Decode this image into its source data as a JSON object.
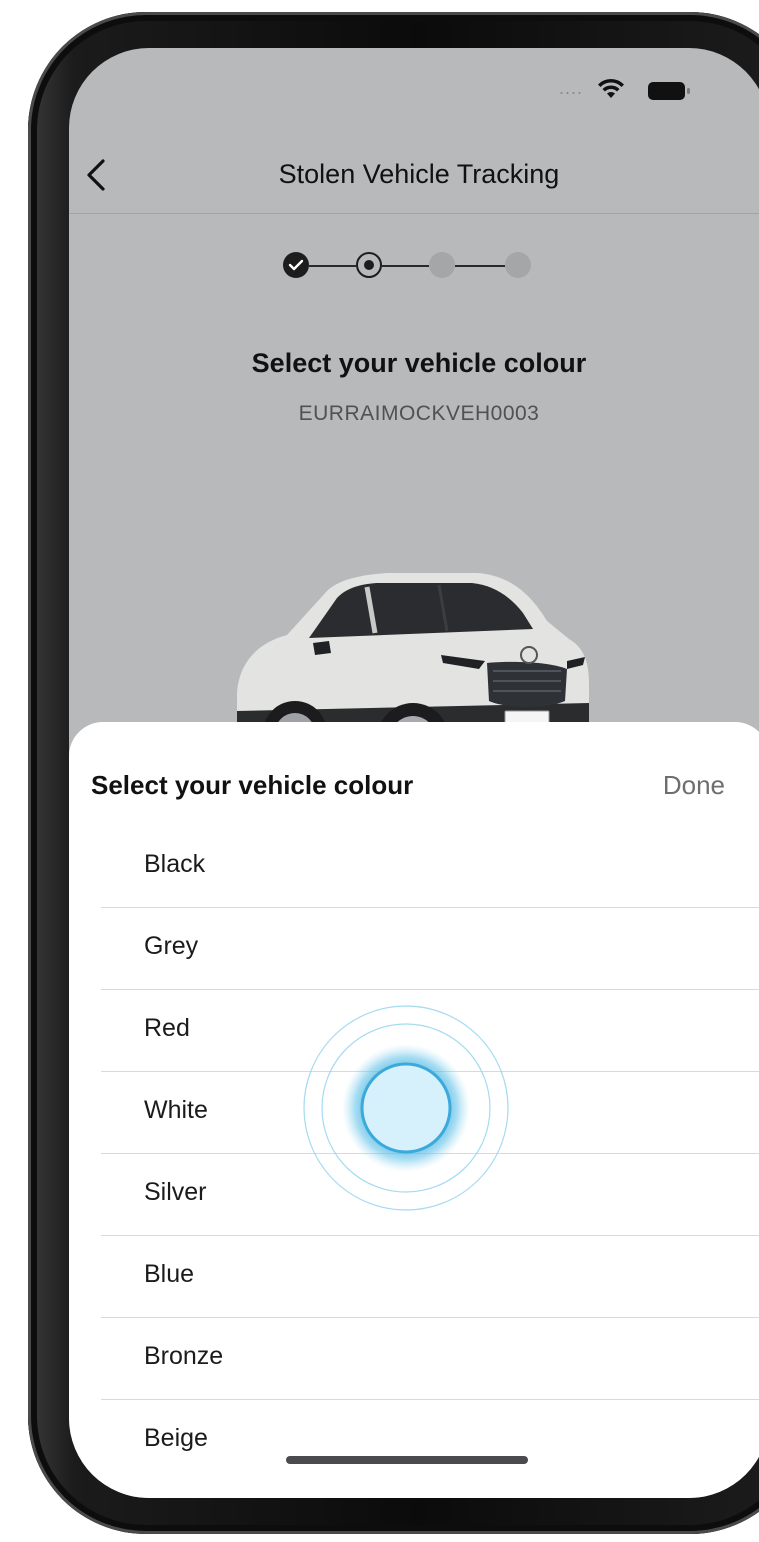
{
  "header": {
    "title": "Stolen Vehicle Tracking"
  },
  "status_bar": {
    "signal": "....",
    "wifi_icon": "wifi-icon",
    "battery_icon": "battery-icon"
  },
  "stepper": {
    "total_steps": 4,
    "current_step": 2
  },
  "main": {
    "heading": "Select your vehicle colour",
    "vin": "EURRAIMOCKVEH0003"
  },
  "sheet": {
    "title": "Select your vehicle colour",
    "done_label": "Done",
    "colours": [
      {
        "label": "Black"
      },
      {
        "label": "Grey"
      },
      {
        "label": "Red"
      },
      {
        "label": "White"
      },
      {
        "label": "Silver"
      },
      {
        "label": "Blue"
      },
      {
        "label": "Bronze"
      },
      {
        "label": "Beige"
      }
    ]
  },
  "colors": {
    "background_dimmed": "#b8b9bb",
    "sheet_background": "#ffffff",
    "touch_accent": "#3aa9dc"
  }
}
